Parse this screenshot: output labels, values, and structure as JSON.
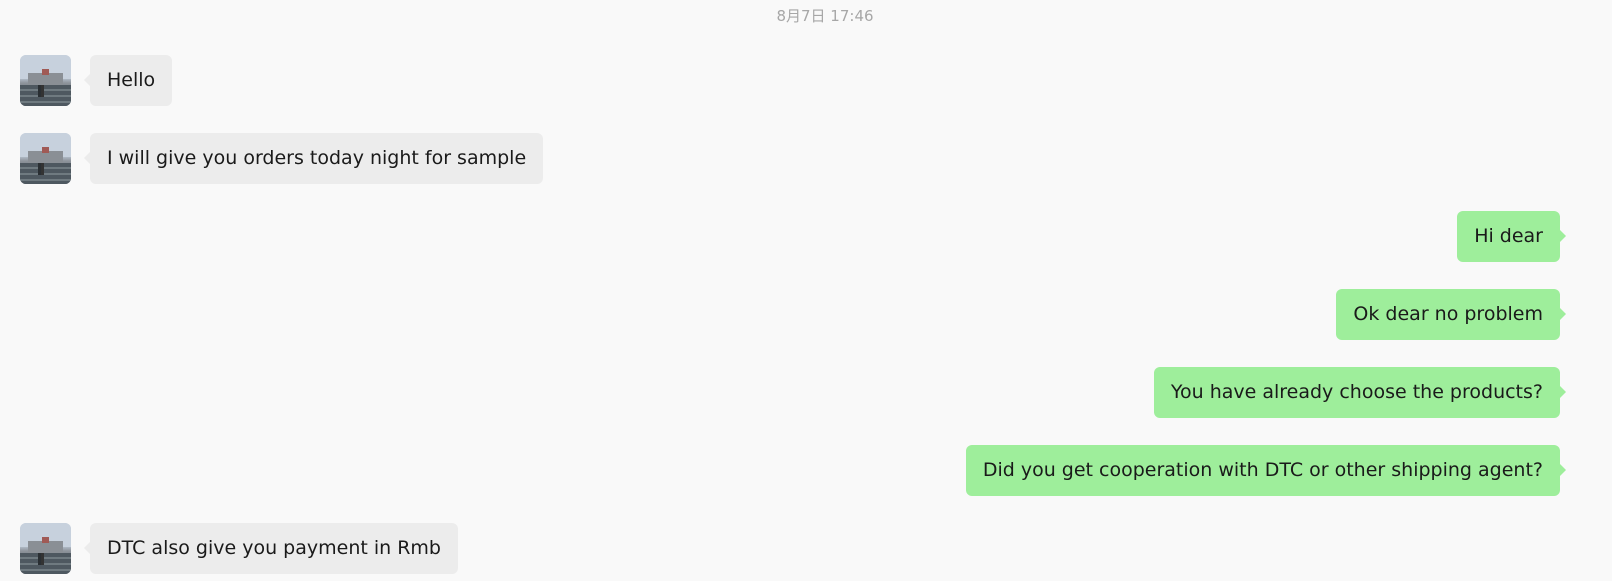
{
  "timestamp": "8月7日 17:46",
  "messages": [
    {
      "side": "left",
      "text": "Hello"
    },
    {
      "side": "left",
      "text": "I will give you orders today night for sample"
    },
    {
      "side": "right",
      "text": "Hi dear"
    },
    {
      "side": "right",
      "text": "Ok dear no problem"
    },
    {
      "side": "right",
      "text": "You have already choose the products?"
    },
    {
      "side": "right",
      "text": "Did you get cooperation with DTC or other shipping agent?"
    },
    {
      "side": "left",
      "text": "DTC also give you payment in Rmb"
    }
  ],
  "colors": {
    "incoming_bubble": "#ececec",
    "outgoing_bubble": "#9eee9b",
    "background": "#f9f9f9",
    "timestamp_text": "#a7a7a7"
  }
}
